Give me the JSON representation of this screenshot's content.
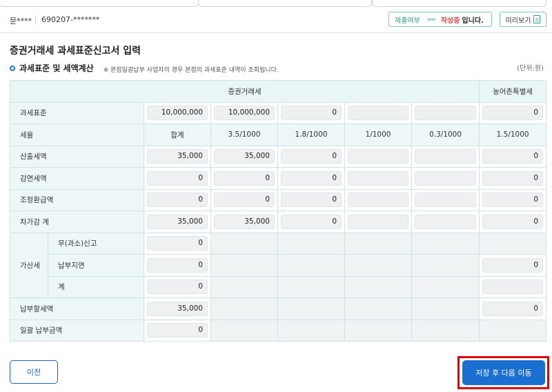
{
  "taxpayer": {
    "name": "문****",
    "id": "690207-*******"
  },
  "status": {
    "label": "제출여부",
    "arrows": "››››",
    "value": "작성중",
    "suffix": "입니다."
  },
  "preview_label": "미리보기",
  "page_title": "증권거래세 과세표준신고서 입력",
  "section": {
    "title": "과세표준 및 세액계산",
    "note": "※ 본점일괄납부 사업자의 경우 본점의 과세표준 내역이 조회됩니다.",
    "unit": "(단위:원)"
  },
  "table": {
    "header_main": "증권거래세",
    "header_extra": "농어촌특별세",
    "tax_base": {
      "label": "과세표준",
      "values": [
        "10,000,000",
        "10,000,000",
        "0",
        "",
        "",
        "0"
      ]
    },
    "rate": {
      "label": "세율",
      "values": [
        "합계",
        "3.5/1000",
        "1.8/1000",
        "1/1000",
        "0.3/1000",
        "1.5/1000"
      ]
    },
    "calc_tax": {
      "label": "산출세액",
      "values": [
        "35,000",
        "35,000",
        "0",
        "",
        "",
        "0"
      ]
    },
    "reduced_tax": {
      "label": "감면세액",
      "values": [
        "0",
        "0",
        "0",
        "",
        "",
        "0"
      ]
    },
    "adjust_refund": {
      "label": "조정환급액",
      "values": [
        "0",
        "0",
        "0",
        "",
        "",
        "0"
      ]
    },
    "net_total": {
      "label": "차가감 계",
      "values": [
        "35,000",
        "35,000",
        "0",
        "",
        "",
        "0"
      ]
    },
    "penalty": {
      "label": "가산세",
      "rows": [
        {
          "label": "무(과소)신고",
          "total": "0",
          "extra": null
        },
        {
          "label": "납부지연",
          "total": "0",
          "extra": "0"
        },
        {
          "label": "계",
          "total": "0",
          "extra": ""
        }
      ]
    },
    "payable": {
      "label": "납부할세액",
      "total": "35,000",
      "extra": "0"
    },
    "lump_sum": {
      "label": "일괄 납부금액",
      "total": "0"
    }
  },
  "buttons": {
    "prev": "이전",
    "next": "저장 후 다음 이동"
  }
}
